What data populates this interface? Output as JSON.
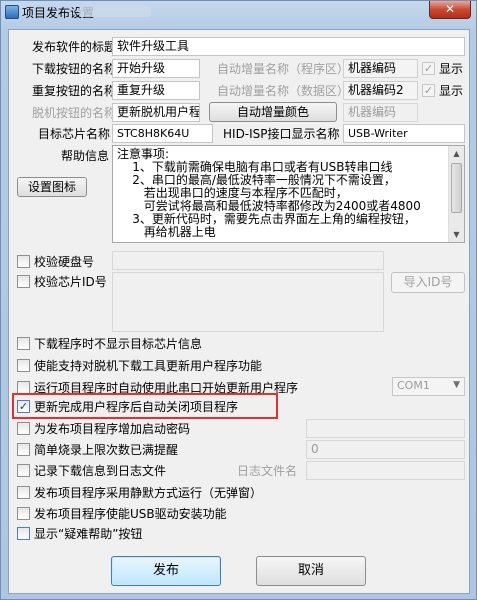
{
  "window": {
    "title": "项目发布设置",
    "close_label": "✕"
  },
  "rows": {
    "publish_title_label": "发布软件的标题",
    "publish_title_value": "软件升级工具",
    "download_btn_label": "下载按钮的名称",
    "download_btn_value": "开始升级",
    "retry_btn_label": "重复按钮的名称",
    "retry_btn_value": "重复升级",
    "offline_btn_label": "脱机按钮的名称",
    "offline_btn_value": "更新脱机用户程",
    "auto_inc_prog_label": "自动增量名称（程序区）",
    "auto_inc_prog_value": "机器编码",
    "auto_inc_data_label": "自动增量名称（数据区）",
    "auto_inc_data_value": "机器编码2",
    "show_label_1": "显示",
    "show_label_2": "显示",
    "auto_inc_color_btn": "自动增量颜色",
    "machine_code_value": "机器编码",
    "target_chip_label": "目标芯片名称",
    "target_chip_value": "STC8H8K64U",
    "hid_label": "HID-ISP接口显示名称",
    "hid_value": "USB-Writer",
    "help_label": "帮助信息",
    "set_icon_btn": "设置图标"
  },
  "help_text": {
    "line1": "注意事项:",
    "line2": "    1、下载前需确保电脑有串口或者有USB转串口线",
    "line3": "    2、串口的最高/最低波特率一般情况下不需设置，",
    "line4": "       若出现串口的速度与本程序不匹配时，",
    "line5": "       可尝试将最高和最低波特率都修改为2400或者4800",
    "line6": "    3、更新代码时，需要先点击界面左上角的编程按钮，",
    "line7": "       再给机器上电"
  },
  "verify": {
    "disk_label": "校验硬盘号",
    "chip_id_label": "校验芯片ID号",
    "import_id_btn": "导入ID号"
  },
  "options": {
    "opt1": "下载程序时不显示目标芯片信息",
    "opt2": "使能支持对脱机下载工具更新用户程序功能",
    "opt3": "运行项目程序时自动使用此串口开始更新用户程序",
    "opt3_combo": "COM1",
    "opt4": "更新完成用户程序后自动关闭项目程序",
    "opt5": "为发布项目程序增加启动密码",
    "opt6": "简单烧录上限次数已满提醒",
    "opt6_value": "0",
    "opt7": "记录下载信息到日志文件",
    "opt7_log_label": "日志文件名",
    "opt8": "发布项目程序采用静默方式运行（无弹窗）",
    "opt9": "发布项目程序使能USB驱动安装功能",
    "opt10": "显示“疑难帮助”按钮"
  },
  "buttons": {
    "publish": "发布",
    "cancel": "取消"
  },
  "colors": {
    "highlight": "#e4322b",
    "titlebar": "#b3cbe5",
    "close_button": "#c94a34"
  }
}
